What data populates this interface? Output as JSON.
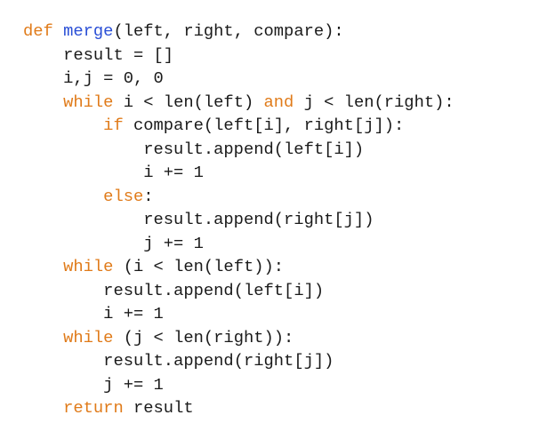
{
  "code": {
    "lines": [
      {
        "indent": "",
        "tokens": [
          {
            "t": "def",
            "kind": "kw"
          },
          {
            "t": " ",
            "kind": "plain"
          },
          {
            "t": "merge",
            "kind": "fn"
          },
          {
            "t": "(left, right, compare):",
            "kind": "plain"
          }
        ]
      },
      {
        "indent": "    ",
        "tokens": [
          {
            "t": "result = []",
            "kind": "plain"
          }
        ]
      },
      {
        "indent": "    ",
        "tokens": [
          {
            "t": "i,j = 0, 0",
            "kind": "plain"
          }
        ]
      },
      {
        "indent": "    ",
        "tokens": [
          {
            "t": "while",
            "kind": "kw"
          },
          {
            "t": " i < len(left) ",
            "kind": "plain"
          },
          {
            "t": "and",
            "kind": "kw"
          },
          {
            "t": " j < len(right):",
            "kind": "plain"
          }
        ]
      },
      {
        "indent": "        ",
        "tokens": [
          {
            "t": "if",
            "kind": "kw"
          },
          {
            "t": " compare(left[i], right[j]):",
            "kind": "plain"
          }
        ]
      },
      {
        "indent": "            ",
        "tokens": [
          {
            "t": "result.append(left[i])",
            "kind": "plain"
          }
        ]
      },
      {
        "indent": "            ",
        "tokens": [
          {
            "t": "i += 1",
            "kind": "plain"
          }
        ]
      },
      {
        "indent": "        ",
        "tokens": [
          {
            "t": "else",
            "kind": "kw"
          },
          {
            "t": ":",
            "kind": "plain"
          }
        ]
      },
      {
        "indent": "            ",
        "tokens": [
          {
            "t": "result.append(right[j])",
            "kind": "plain"
          }
        ]
      },
      {
        "indent": "            ",
        "tokens": [
          {
            "t": "j += 1",
            "kind": "plain"
          }
        ]
      },
      {
        "indent": "    ",
        "tokens": [
          {
            "t": "while",
            "kind": "kw"
          },
          {
            "t": " (i < len(left)):",
            "kind": "plain"
          }
        ]
      },
      {
        "indent": "        ",
        "tokens": [
          {
            "t": "result.append(left[i])",
            "kind": "plain"
          }
        ]
      },
      {
        "indent": "        ",
        "tokens": [
          {
            "t": "i += 1",
            "kind": "plain"
          }
        ]
      },
      {
        "indent": "    ",
        "tokens": [
          {
            "t": "while",
            "kind": "kw"
          },
          {
            "t": " (j < len(right)):",
            "kind": "plain"
          }
        ]
      },
      {
        "indent": "        ",
        "tokens": [
          {
            "t": "result.append(right[j])",
            "kind": "plain"
          }
        ]
      },
      {
        "indent": "        ",
        "tokens": [
          {
            "t": "j += 1",
            "kind": "plain"
          }
        ]
      },
      {
        "indent": "    ",
        "tokens": [
          {
            "t": "return",
            "kind": "kw"
          },
          {
            "t": " result",
            "kind": "plain"
          }
        ]
      }
    ]
  },
  "colors": {
    "keyword": "#e07b1a",
    "function_name": "#2a4fd6",
    "text": "#1a1a1a",
    "background": "#ffffff"
  }
}
